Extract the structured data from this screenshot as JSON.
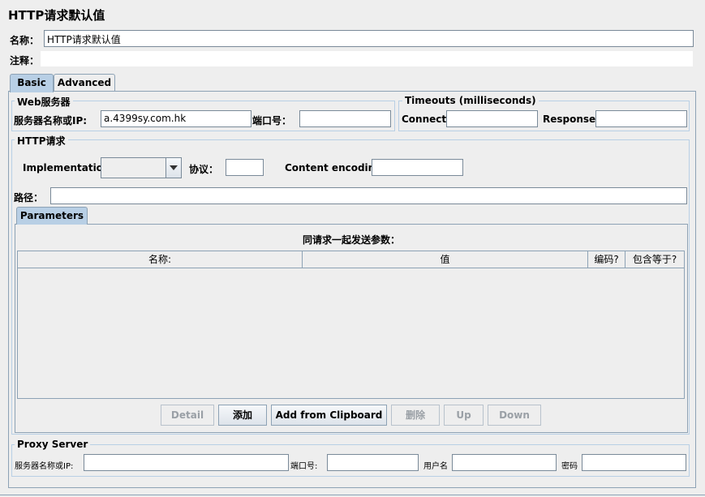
{
  "window": {
    "title": "HTTP请求默认值"
  },
  "name_field": {
    "label": "名称：",
    "value": "HTTP请求默认值"
  },
  "comment_field": {
    "label": "注释：",
    "value": ""
  },
  "tabs": [
    {
      "label": "Basic",
      "active": true
    },
    {
      "label": "Advanced",
      "active": false
    }
  ],
  "web_server": {
    "legend": "Web服务器",
    "server_label": "服务器名称或IP:",
    "server_value": "a.4399sy.com.hk",
    "port_label": "端口号：",
    "port_value": ""
  },
  "timeouts": {
    "legend": "Timeouts (milliseconds)",
    "connect_label": "Connect:",
    "connect_value": "",
    "response_label": "Response:",
    "response_value": ""
  },
  "http_request": {
    "legend": "HTTP请求",
    "implementation_label": "Implementation:",
    "implementation_value": "",
    "protocol_label": "协议：",
    "protocol_value": "",
    "encoding_label": "Content encoding:",
    "encoding_value": "",
    "path_label": "路径：",
    "path_value": ""
  },
  "parameters": {
    "tab_label": "Parameters",
    "heading": "同请求一起发送参数：",
    "columns": [
      "名称:",
      "值",
      "编码?",
      "包含等于?"
    ],
    "rows": []
  },
  "buttons": {
    "detail": "Detail",
    "add": "添加",
    "add_clipboard": "Add from Clipboard",
    "delete": "删除",
    "up": "Up",
    "down": "Down"
  },
  "proxy": {
    "legend": "Proxy Server",
    "server_label": "服务器名称或IP:",
    "server_value": "",
    "port_label": "端口号:",
    "port_value": "",
    "user_label": "用户名",
    "user_value": "",
    "password_label": "密码",
    "password_value": ""
  },
  "colors": {
    "tab_active": "#b8cfe5",
    "border": "#8da2b5",
    "background": "#eeeeee"
  }
}
